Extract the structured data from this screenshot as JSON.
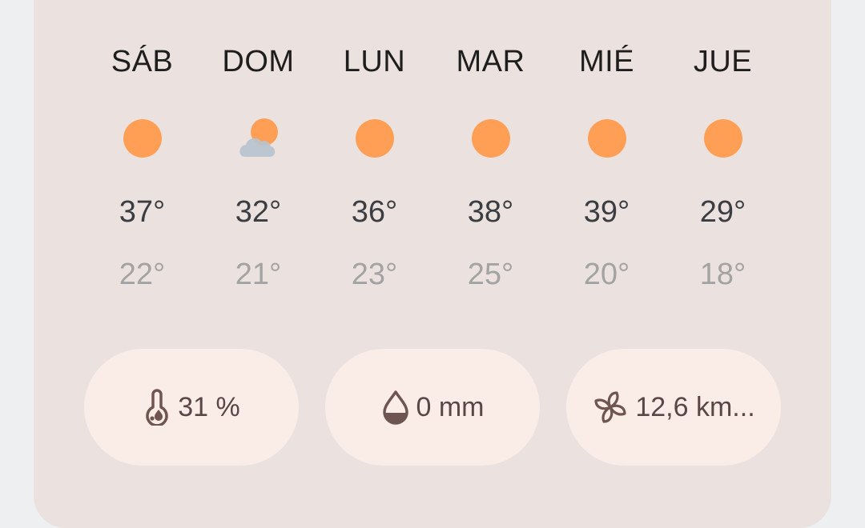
{
  "colors": {
    "sun": "#FF9F55",
    "cloud": "#B7C3CF",
    "high": "#3A3D42",
    "low": "#A3A3A3",
    "chip_bg": "#FAECE6",
    "chip_icon": "#6E5552"
  },
  "forecast": [
    {
      "day": "SÁB",
      "icon": "sun-icon",
      "high": "37°",
      "low": "22°"
    },
    {
      "day": "DOM",
      "icon": "partly-cloudy-icon",
      "high": "32°",
      "low": "21°"
    },
    {
      "day": "LUN",
      "icon": "sun-icon",
      "high": "36°",
      "low": "23°"
    },
    {
      "day": "MAR",
      "icon": "sun-icon",
      "high": "38°",
      "low": "25°"
    },
    {
      "day": "MIÉ",
      "icon": "sun-icon",
      "high": "39°",
      "low": "20°"
    },
    {
      "day": "JUE",
      "icon": "sun-icon",
      "high": "29°",
      "low": "18°"
    }
  ],
  "details": {
    "humidity": {
      "icon": "humidity-icon",
      "value": "31 %"
    },
    "precipitation": {
      "icon": "raindrop-icon",
      "value": "0 mm"
    },
    "wind": {
      "icon": "wind-icon",
      "value": "12,6 km..."
    }
  }
}
